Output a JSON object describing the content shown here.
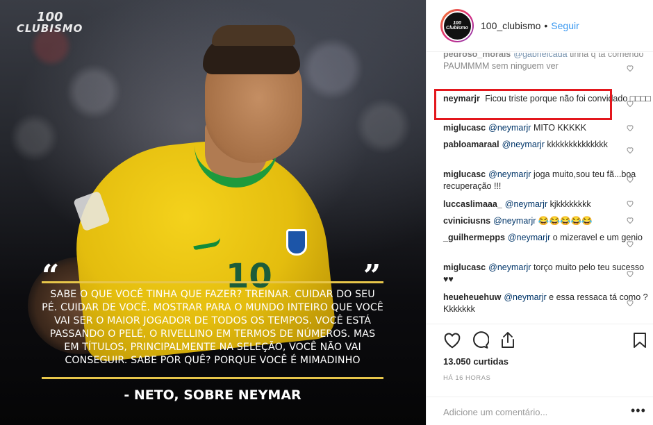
{
  "image": {
    "logo_top": "100",
    "logo_bottom": "CLUBISMO",
    "jersey_number": "10",
    "quote_open": "“",
    "quote_close": "”",
    "quote": "SABE O QUE VOCÊ TINHA QUE FAZER? TREINAR. CUIDAR DO SEU PÉ. CUIDAR DE VOCÊ. MOSTRAR PARA O MUNDO INTEIRO QUE VOCÊ VAI SER O MAIOR JOGADOR DE TODOS OS TEMPOS. VOCÊ ESTÁ PASSANDO O PELÉ, O RIVELLINO EM TERMOS DE NÚMEROS. MAS EM TÍTULOS, PRINCIPALMENTE NA SELEÇÃO, VOCÊ NÃO VAI CONSEGUIR. SABE POR QUÊ? PORQUE VOCÊ É MIMADINHO",
    "author": "- NETO, SOBRE NEYMAR"
  },
  "header": {
    "avatar_text": "100 Clubismo",
    "username": "100_clubismo",
    "separator": "•",
    "follow_label": "Seguir"
  },
  "comments": [
    {
      "user": "pedroso_morais",
      "mention": "@gabrielcada",
      "text": "tinha q ta comendo PAUMMMM sem ninguem ver"
    },
    {
      "user": "neymarjr",
      "mention": "",
      "text": "Ficou triste porque não foi convidado □□□□"
    },
    {
      "user": "miglucasc",
      "mention": "@neymarjr",
      "text": "MITO KKKKK"
    },
    {
      "user": "pabloamaraal",
      "mention": "@neymarjr",
      "text": "kkkkkkkkkkkkkk"
    },
    {
      "user": "miglucasc",
      "mention": "@neymarjr",
      "text": "joga muito,sou teu fã...boa recuperação !!!"
    },
    {
      "user": "luccaslimaaa_",
      "mention": "@neymarjr",
      "text": "kjkkkkkkkk"
    },
    {
      "user": "cviniciusns",
      "mention": "@neymarjr",
      "text": "😂😂😂😂😂"
    },
    {
      "user": "_guilhermepps",
      "mention": "@neymarjr",
      "text": "o mizeravel e um genio"
    },
    {
      "user": "miglucasc",
      "mention": "@neymarjr",
      "text": "torço muito pelo teu sucesso ♥♥"
    },
    {
      "user": "heueheuehuw",
      "mention": "@neymarjr",
      "text": "e essa ressaca tá como ? Kkkkkkk"
    }
  ],
  "stats": {
    "likes": "13.050 curtidas",
    "time": "HÁ 16 HORAS"
  },
  "add_comment": {
    "placeholder": "Adicione um comentário...",
    "more_label": "•••"
  },
  "icons": [
    "heart-icon",
    "comment-icon",
    "share-icon",
    "bookmark-icon",
    "more-icon"
  ],
  "colors": {
    "accent": "#3897f0",
    "highlight": "#e3171d",
    "gold": "#e7c64a",
    "jersey": "#f0cc16"
  }
}
